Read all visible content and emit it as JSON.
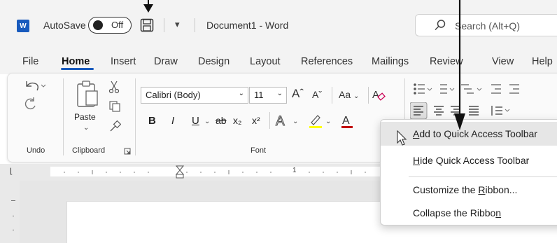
{
  "title_bar": {
    "app_icon_letter": "W",
    "autosave_label": "AutoSave",
    "autosave_state": "Off",
    "qat_dropdown_glyph": "▾",
    "doc_title": "Document1  -  Word",
    "search_placeholder": "Search (Alt+Q)"
  },
  "tabs": [
    "File",
    "Home",
    "Insert",
    "Draw",
    "Design",
    "Layout",
    "References",
    "Mailings",
    "Review",
    "View",
    "Help"
  ],
  "active_tab": "Home",
  "ribbon": {
    "groups": [
      "Undo",
      "Clipboard",
      "Font"
    ],
    "paste_label": "Paste",
    "font_name": "Calibri (Body)",
    "font_size": "11",
    "font_buttons": [
      "B",
      "I",
      "U",
      "ab",
      "x₂",
      "x²"
    ],
    "case_label": "Aa"
  },
  "ruler_mark": "1",
  "context_menu": {
    "items": [
      {
        "label": "Add to Quick Access Toolbar",
        "accel": "A",
        "hover": true
      },
      {
        "label": "Hide Quick Access Toolbar",
        "accel": "H",
        "hover": false
      },
      {
        "label": "Customize the Ribbon...",
        "accel": "R",
        "hover": false
      },
      {
        "label": "Collapse the Ribbon",
        "accel": "n",
        "hover": false
      }
    ]
  },
  "colors": {
    "accent": "#185abd",
    "font_color_bar": "#c00000",
    "highlight_bar": "#ffff00"
  }
}
